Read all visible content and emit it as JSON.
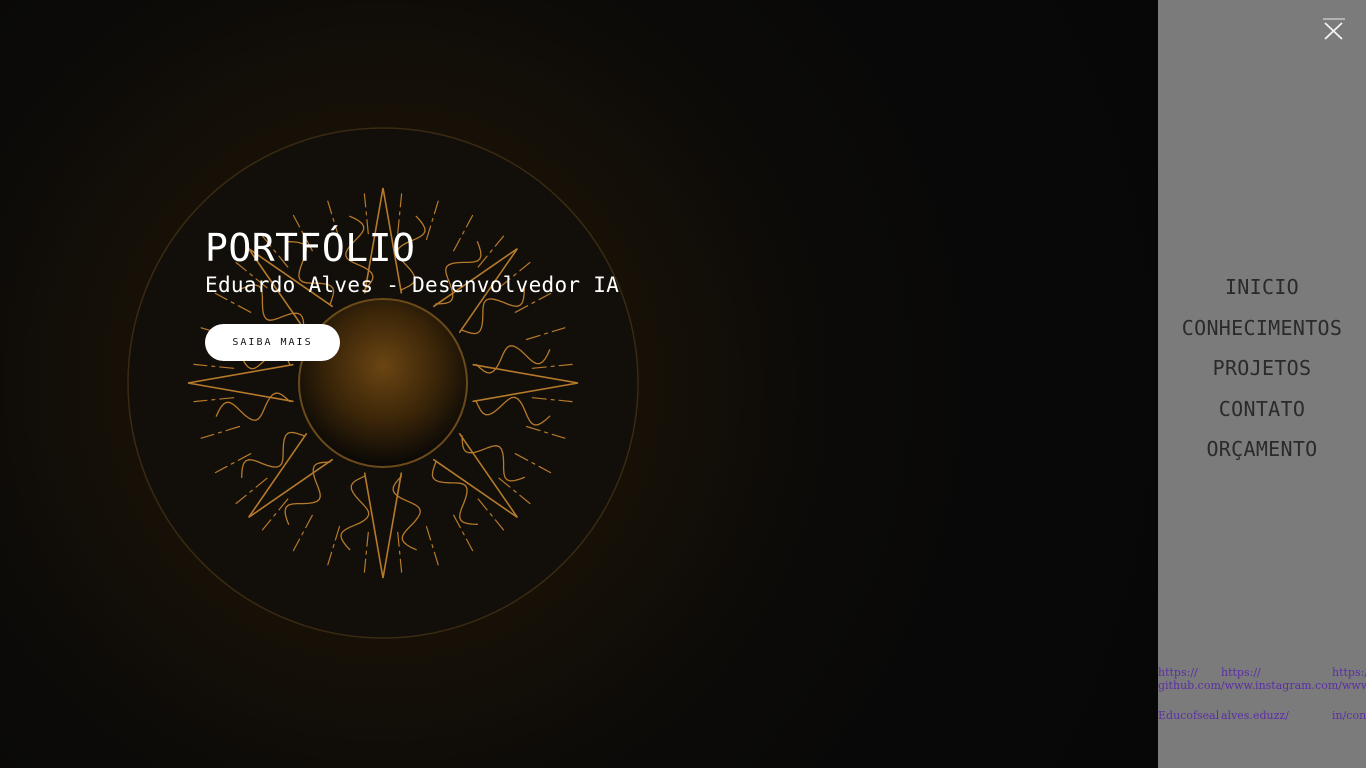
{
  "hero": {
    "title": "PORTFÓLIO",
    "subtitle": "Eduardo Alves - Desenvolvedor IA",
    "cta_label": "SAIBA MAIS",
    "emblem_icon": "sun-emblem-icon"
  },
  "menu": {
    "close_icon": "close-icon",
    "items": [
      {
        "label": "INICIO"
      },
      {
        "label": "CONHECIMENTOS"
      },
      {
        "label": "PROJETOS"
      },
      {
        "label": "CONTATO"
      },
      {
        "label": "ORÇAMENTO"
      }
    ],
    "social_fragments": [
      "https://",
      "https://",
      "https:/",
      "github.com/www.instagram.com/www.li",
      "Educofseal",
      "alves.eduzz/",
      "in/cont"
    ]
  },
  "colors": {
    "menu_background": "#7b7b7b",
    "hero_background": "#080808",
    "accent_gold": "#b57a2c",
    "link_purple": "#5b2ea6"
  }
}
